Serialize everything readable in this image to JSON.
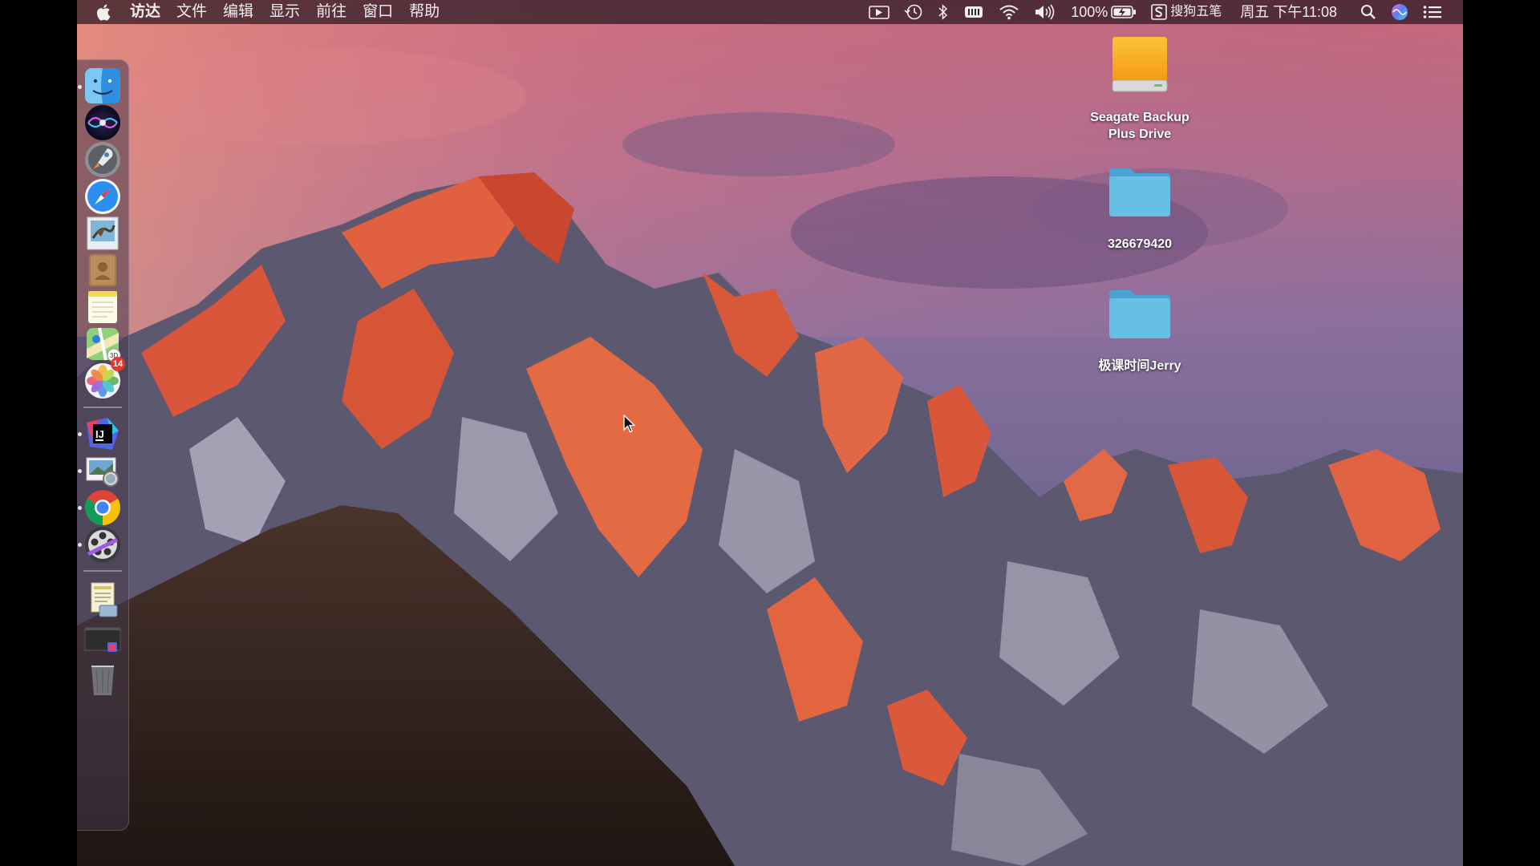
{
  "menubar": {
    "app_name": "访达",
    "menus": [
      "文件",
      "编辑",
      "显示",
      "前往",
      "窗口",
      "帮助"
    ],
    "battery_percent": "100%",
    "input_method": "搜狗五笔",
    "datetime": "周五 下午11:08"
  },
  "dock": {
    "items": [
      {
        "name": "finder-icon",
        "running": true
      },
      {
        "name": "siri-icon",
        "running": false
      },
      {
        "name": "launchpad-icon",
        "running": false
      },
      {
        "name": "safari-icon",
        "running": false
      },
      {
        "name": "mail-icon",
        "running": false
      },
      {
        "name": "contacts-icon",
        "running": false
      },
      {
        "name": "notes-icon",
        "running": false
      },
      {
        "name": "maps-icon",
        "running": false
      },
      {
        "name": "photos-icon",
        "running": false,
        "badge": "14"
      },
      {
        "name": "intellij-idea-icon",
        "running": true
      },
      {
        "name": "preview-icon",
        "running": true
      },
      {
        "name": "chrome-icon",
        "running": true
      },
      {
        "name": "video-app-icon",
        "running": true
      },
      {
        "name": "downloads-stack-icon",
        "running": false
      },
      {
        "name": "screenshot-stack-icon",
        "running": false
      },
      {
        "name": "trash-icon",
        "running": false
      }
    ]
  },
  "desktop": {
    "icons": [
      {
        "label": "Seagate Backup Plus Drive",
        "type": "drive"
      },
      {
        "label": "326679420",
        "type": "folder"
      },
      {
        "label": "极课时间Jerry",
        "type": "folder"
      }
    ]
  },
  "colors": {
    "folder_blue": "#5bb6de",
    "drive_orange": "#f6a41c",
    "badge_red": "#e6352c",
    "menubar_bg": "#2a1620"
  }
}
